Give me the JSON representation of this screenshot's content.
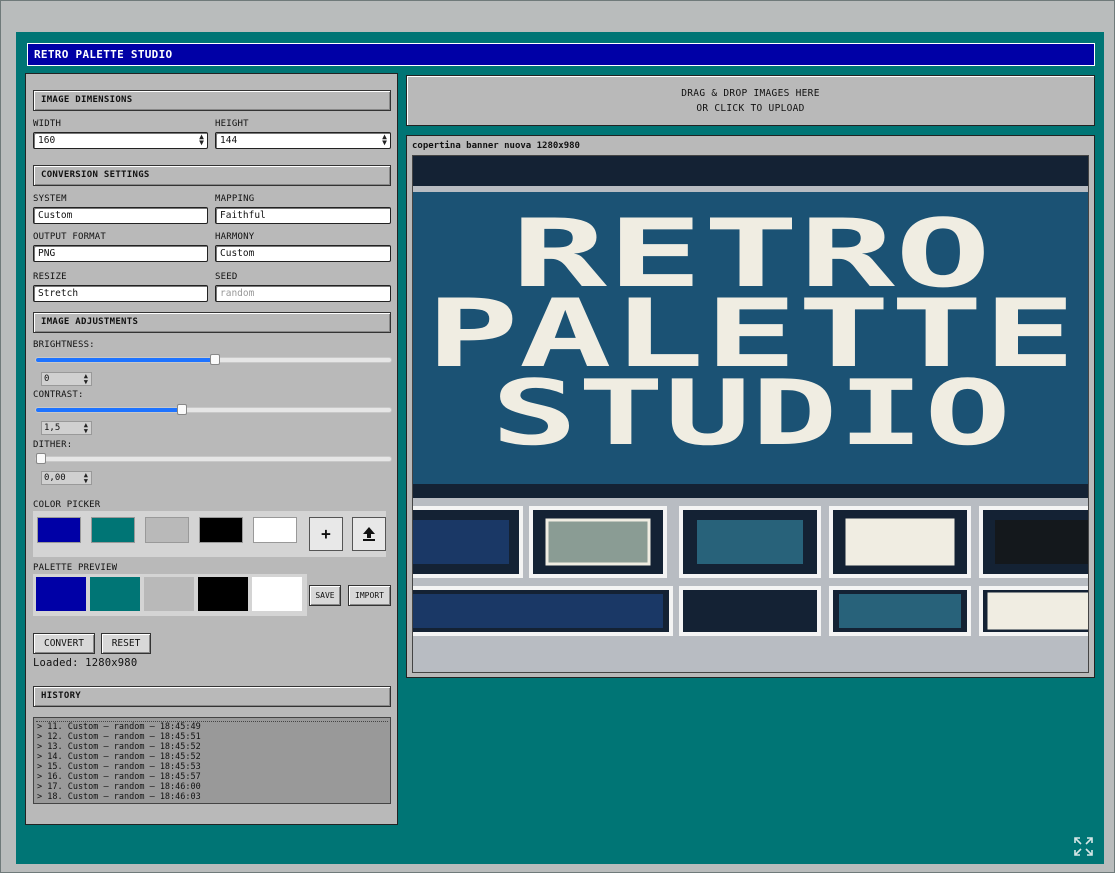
{
  "app": {
    "title": "RETRO PALETTE STUDIO"
  },
  "dimensions": {
    "header": "IMAGE DIMENSIONS",
    "width_label": "WIDTH",
    "width_value": "160",
    "height_label": "HEIGHT",
    "height_value": "144"
  },
  "conversion": {
    "header": "CONVERSION SETTINGS",
    "system_label": "SYSTEM",
    "system_value": "Custom",
    "mapping_label": "MAPPING",
    "mapping_value": "Faithful",
    "output_label": "OUTPUT FORMAT",
    "output_value": "PNG",
    "harmony_label": "HARMONY",
    "harmony_value": "Custom",
    "resize_label": "RESIZE",
    "resize_value": "Stretch",
    "seed_label": "SEED",
    "seed_placeholder": "random"
  },
  "adjustments": {
    "header": "IMAGE ADJUSTMENTS",
    "brightness_label": "BRIGHTNESS:",
    "brightness_value": "0",
    "brightness_fraction": 0.5,
    "contrast_label": "CONTRAST:",
    "contrast_value": "1,5",
    "contrast_fraction": 0.405,
    "dither_label": "DITHER:",
    "dither_value": "0,00",
    "dither_fraction": 0.0
  },
  "color_picker": {
    "label": "COLOR PICKER",
    "swatches": [
      "#0000a6",
      "#007575",
      "#b9b9b9",
      "#000000",
      "#ffffff"
    ],
    "add_icon": "plus-icon",
    "upload_icon": "upload-icon"
  },
  "palette_preview": {
    "label": "PALETTE PREVIEW",
    "swatches": [
      "#0000a6",
      "#007575",
      "#b9b9b9",
      "#000000",
      "#ffffff"
    ],
    "save_label": "SAVE",
    "import_label": "IMPORT"
  },
  "actions": {
    "convert_label": "CONVERT",
    "reset_label": "RESET",
    "status": "Loaded: 1280x980"
  },
  "history": {
    "header": "HISTORY",
    "items": [
      "> 11. Custom – random – 18:45:49",
      "> 12. Custom – random – 18:45:51",
      "> 13. Custom – random – 18:45:52",
      "> 14. Custom – random – 18:45:52",
      "> 15. Custom – random – 18:45:53",
      "> 16. Custom – random – 18:45:57",
      "> 17. Custom – random – 18:46:00",
      "> 18. Custom – random – 18:46:03"
    ]
  },
  "dropzone": {
    "line1": "DRAG & DROP IMAGES HERE",
    "line2": "OR CLICK TO UPLOAD"
  },
  "preview": {
    "filename": "copertina banner nuova 1280x980",
    "image_text_lines": [
      "RETRO",
      "PALETTE",
      "STUDIO"
    ],
    "image_colors": {
      "dark": "#142234",
      "blue": "#1b5274",
      "cream": "#f0ede2",
      "navy": "#1a3866",
      "gray": "#8a9c94",
      "teal": "#28627a",
      "black": "#14181c"
    }
  },
  "corner": {
    "icon": "expand-icon"
  }
}
